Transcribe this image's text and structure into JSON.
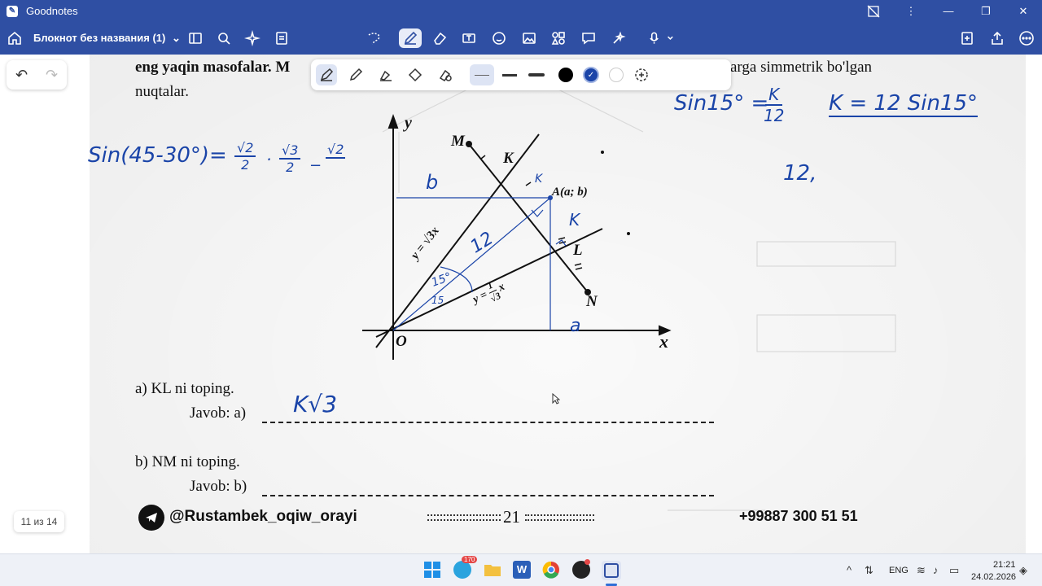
{
  "titlebar": {
    "app_name": "Goodnotes",
    "minimize": "—",
    "maximize": "❐",
    "close": "✕"
  },
  "toolbar": {
    "doc_title": "Блокнот без названия (1)",
    "doc_chevron": "⌄"
  },
  "undo_redo": {
    "undo": "↶",
    "redo": "↷"
  },
  "pen_palette": {
    "active_color": "#1a44a8",
    "colors": [
      "#000000",
      "#1a44a8",
      "#ffffff"
    ]
  },
  "book_page": {
    "line1": "eng yaqin masofalar. M",
    "line1_tail": "arga simmetrik bo'lgan",
    "line2": "nuqtalar.",
    "q_a": "a) KL ni toping.",
    "ans_a": "Javob: a)",
    "q_b": "b) NM ni toping.",
    "ans_b": "Javob: b)",
    "footer_handle": "@Rustambek_oqiw_orayi",
    "footer_page": "21",
    "footer_phone": "+99887 300 51 51",
    "fig_label_y": "y",
    "fig_label_x": "x",
    "fig_label_O": "O",
    "fig_label_M": "M",
    "fig_label_K": "K",
    "fig_label_A": "A(a; b)",
    "fig_label_L": "L",
    "fig_label_N": "N",
    "fig_line1": "y = √3x",
    "fig_line2_lhs": "y =",
    "fig_line2_num": "1",
    "fig_line2_den": "√3",
    "fig_line2_x": "x"
  },
  "handwriting": {
    "top_left": "Sin(45-30°)=",
    "frac1_num": "√2",
    "frac1_den": "2",
    "dot": "·",
    "frac2_num": "√3",
    "frac2_den": "2",
    "minus": "−",
    "frac3_num": "√2",
    "sin_eq": "Sin15° =",
    "sin_frac_num": "K",
    "sin_frac_den": "12",
    "k_eq": "K = 12 Sin15°",
    "twelve": "12,",
    "b_mark": "b",
    "twelve_seg": "12",
    "k_small": "K",
    "k_mid": "K",
    "angle_top": "15°",
    "angle_bot": "15",
    "a_mark": "a",
    "answer_a": "K√3"
  },
  "page_counter": "11 из 14",
  "taskbar": {
    "telegram_badge": "170",
    "lang": "ENG",
    "time": "21:21",
    "date": "24.02.2026"
  }
}
